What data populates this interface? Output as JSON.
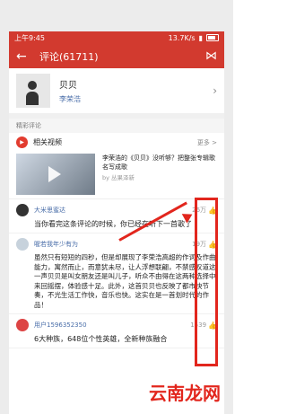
{
  "status_bar": {
    "time": "上午9:45",
    "network": "13.7K/s",
    "battery": "100"
  },
  "header": {
    "title": "评论(61711)"
  },
  "song": {
    "title": "贝贝",
    "artist": "李荣浩"
  },
  "section": {
    "featured_label": "精彩评论"
  },
  "video": {
    "label": "相关视频",
    "more_label": "更多 >",
    "title": "李荣浩的《贝贝》没听够？把整张专辑歌名写成歌",
    "author": "by 丛果泽新"
  },
  "comments": [
    {
      "user": "大米思蜜达",
      "likes": "26万",
      "text": "当你看完这条评论的时候，你已经在听下一首歌了"
    },
    {
      "user": "喔若我年少有为",
      "likes": "19万",
      "text": "虽然只有短短的四秒，但是却展现了李荣浩高超的作词及作曲能力，寓然而止，而意犹未尽，让人浮想联翩，不禁感叹道这一声贝贝是叫女朋友还是叫儿子，听众不由得在这两种选择中来回摇摆，体验感十足。此外，这首贝贝也反映了都市快节奏，不光生活工作快，音乐也快。这实在是一首划时代的作品！"
    },
    {
      "user": "用户1596352350",
      "likes": "1539",
      "text": "6大种族，648位个性英雄，全新种族融合"
    }
  ],
  "watermark": "云南龙网"
}
